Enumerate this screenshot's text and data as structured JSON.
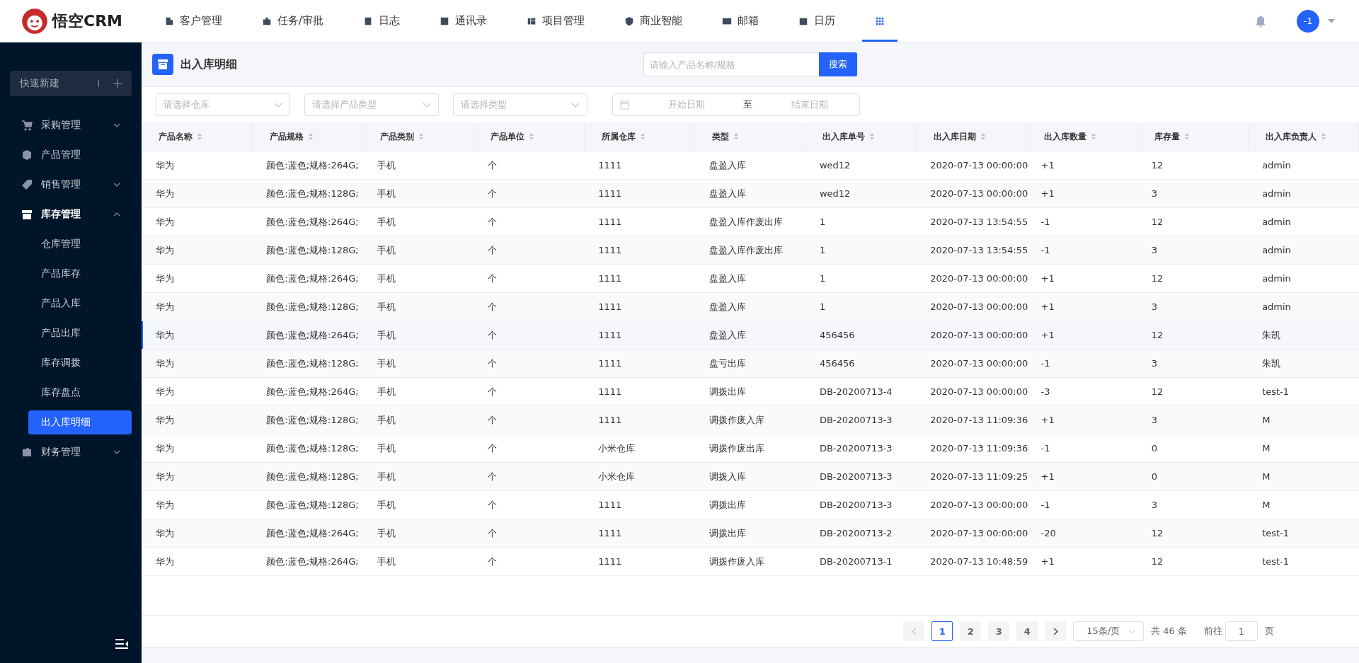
{
  "brand": {
    "name": "悟空CRM"
  },
  "nav": [
    {
      "label": "客户管理",
      "selected": false
    },
    {
      "label": "任务/审批",
      "selected": false
    },
    {
      "label": "日志",
      "selected": false
    },
    {
      "label": "通讯录",
      "selected": false
    },
    {
      "label": "项目管理",
      "selected": false
    },
    {
      "label": "商业智能",
      "selected": false
    },
    {
      "label": "邮箱",
      "selected": false
    },
    {
      "label": "日历",
      "selected": false
    }
  ],
  "apps_menu": {
    "selected": true
  },
  "user": {
    "avatar": "-1"
  },
  "sidebar": {
    "quick_create": "快速新建",
    "items": [
      {
        "label": "采购管理",
        "kind": "group",
        "expanded": false
      },
      {
        "label": "产品管理",
        "kind": "link"
      },
      {
        "label": "销售管理",
        "kind": "group",
        "expanded": false
      },
      {
        "label": "库存管理",
        "kind": "group",
        "expanded": true,
        "children": [
          {
            "label": "仓库管理",
            "selected": false
          },
          {
            "label": "产品库存",
            "selected": false
          },
          {
            "label": "产品入库",
            "selected": false
          },
          {
            "label": "产品出库",
            "selected": false
          },
          {
            "label": "库存调拨",
            "selected": false
          },
          {
            "label": "库存盘点",
            "selected": false
          },
          {
            "label": "出入库明细",
            "selected": true
          }
        ]
      },
      {
        "label": "财务管理",
        "kind": "group",
        "expanded": false
      }
    ]
  },
  "page": {
    "title": "出入库明细",
    "search": {
      "placeholder": "请输入产品名称/规格",
      "button": "搜索"
    }
  },
  "filters": {
    "selects": [
      {
        "placeholder": "请选择仓库"
      },
      {
        "placeholder": "请选择产品类型"
      },
      {
        "placeholder": "请选择类型"
      }
    ],
    "date_range": {
      "start_placeholder": "开始日期",
      "separator": "至",
      "end_placeholder": "结束日期"
    }
  },
  "table": {
    "columns": [
      "产品名称",
      "产品规格",
      "产品类别",
      "产品单位",
      "所属仓库",
      "类型",
      "出入库单号",
      "出入库日期",
      "出入库数量",
      "库存量",
      "出入库负责人"
    ],
    "rows": [
      {
        "selected": false,
        "cells": [
          "华为",
          "颜色:蓝色;规格:264G;",
          "手机",
          "个",
          "1111",
          "盘盈入库",
          "wed12",
          "2020-07-13 00:00:00",
          "+1",
          "12",
          "admin"
        ]
      },
      {
        "selected": false,
        "cells": [
          "华为",
          "颜色:蓝色;规格:128G;",
          "手机",
          "个",
          "1111",
          "盘盈入库",
          "wed12",
          "2020-07-13 00:00:00",
          "+1",
          "3",
          "admin"
        ]
      },
      {
        "selected": false,
        "cells": [
          "华为",
          "颜色:蓝色;规格:264G;",
          "手机",
          "个",
          "1111",
          "盘盈入库作废出库",
          "1",
          "2020-07-13 13:54:55",
          "-1",
          "12",
          "admin"
        ]
      },
      {
        "selected": false,
        "cells": [
          "华为",
          "颜色:蓝色;规格:128G;",
          "手机",
          "个",
          "1111",
          "盘盈入库作废出库",
          "1",
          "2020-07-13 13:54:55",
          "-1",
          "3",
          "admin"
        ]
      },
      {
        "selected": false,
        "cells": [
          "华为",
          "颜色:蓝色;规格:264G;",
          "手机",
          "个",
          "1111",
          "盘盈入库",
          "1",
          "2020-07-13 00:00:00",
          "+1",
          "12",
          "admin"
        ]
      },
      {
        "selected": false,
        "cells": [
          "华为",
          "颜色:蓝色;规格:128G;",
          "手机",
          "个",
          "1111",
          "盘盈入库",
          "1",
          "2020-07-13 00:00:00",
          "+1",
          "3",
          "admin"
        ]
      },
      {
        "selected": true,
        "cells": [
          "华为",
          "颜色:蓝色;规格:264G;",
          "手机",
          "个",
          "1111",
          "盘盈入库",
          "456456",
          "2020-07-13 00:00:00",
          "+1",
          "12",
          "朱凯"
        ]
      },
      {
        "selected": false,
        "cells": [
          "华为",
          "颜色:蓝色;规格:128G;",
          "手机",
          "个",
          "1111",
          "盘亏出库",
          "456456",
          "2020-07-13 00:00:00",
          "-1",
          "3",
          "朱凯"
        ]
      },
      {
        "selected": false,
        "cells": [
          "华为",
          "颜色:蓝色;规格:264G;",
          "手机",
          "个",
          "1111",
          "调拨出库",
          "DB-20200713-4",
          "2020-07-13 00:00:00",
          "-3",
          "12",
          "test-1"
        ]
      },
      {
        "selected": false,
        "cells": [
          "华为",
          "颜色:蓝色;规格:128G;",
          "手机",
          "个",
          "1111",
          "调拨作废入库",
          "DB-20200713-3",
          "2020-07-13 11:09:36",
          "+1",
          "3",
          "M"
        ]
      },
      {
        "selected": false,
        "cells": [
          "华为",
          "颜色:蓝色;规格:128G;",
          "手机",
          "个",
          "小米仓库",
          "调拨作废出库",
          "DB-20200713-3",
          "2020-07-13 11:09:36",
          "-1",
          "0",
          "M"
        ]
      },
      {
        "selected": false,
        "cells": [
          "华为",
          "颜色:蓝色;规格:128G;",
          "手机",
          "个",
          "小米仓库",
          "调拨入库",
          "DB-20200713-3",
          "2020-07-13 11:09:25",
          "+1",
          "0",
          "M"
        ]
      },
      {
        "selected": false,
        "cells": [
          "华为",
          "颜色:蓝色;规格:128G;",
          "手机",
          "个",
          "1111",
          "调拨出库",
          "DB-20200713-3",
          "2020-07-13 00:00:00",
          "-1",
          "3",
          "M"
        ]
      },
      {
        "selected": false,
        "cells": [
          "华为",
          "颜色:蓝色;规格:264G;",
          "手机",
          "个",
          "1111",
          "调拨出库",
          "DB-20200713-2",
          "2020-07-13 00:00:00",
          "-20",
          "12",
          "test-1"
        ]
      },
      {
        "selected": false,
        "cells": [
          "华为",
          "颜色:蓝色;规格:264G;",
          "手机",
          "个",
          "1111",
          "调拨作废入库",
          "DB-20200713-1",
          "2020-07-13 10:48:59",
          "+1",
          "12",
          "test-1"
        ]
      }
    ]
  },
  "pagination": {
    "prev_disabled": true,
    "pages": [
      {
        "label": "1",
        "selected": true
      },
      {
        "label": "2",
        "selected": false
      },
      {
        "label": "3",
        "selected": false
      },
      {
        "label": "4",
        "selected": false
      }
    ],
    "page_size": "15条/页",
    "total": "共 46 条",
    "goto_label": "前往",
    "goto_value": "1",
    "goto_suffix": "页"
  }
}
